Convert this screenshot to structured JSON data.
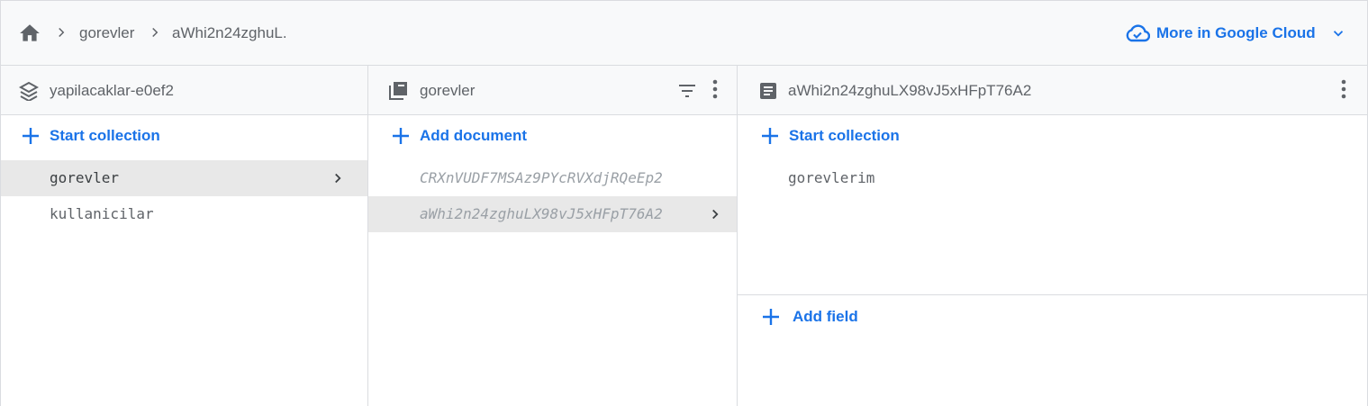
{
  "breadcrumb": {
    "home_icon": "home-icon",
    "items": [
      "gorevler",
      "aWhi2n24zghuL."
    ]
  },
  "cloud_button": {
    "label": "More in Google Cloud",
    "icon": "cloud-icon",
    "accent": "#1a73e8"
  },
  "panels": {
    "root": {
      "title": "yapilacaklar-e0ef2",
      "icon": "database-layers-icon",
      "action": "Start collection",
      "items": [
        "gorevler",
        "kullanicilar"
      ],
      "selected_index": 0
    },
    "collection": {
      "title": "gorevler",
      "icon": "collection-icon",
      "action": "Add document",
      "items": [
        "CRXnVUDF7MSAz9PYcRVXdjRQeEp2",
        "aWhi2n24zghuLX98vJ5xHFpT76A2"
      ],
      "selected_index": 1
    },
    "document": {
      "title": "aWhi2n24zghuLX98vJ5xHFpT76A2",
      "icon": "document-icon",
      "action": "Start collection",
      "items": [
        "gorevlerim"
      ],
      "add_field": "Add field"
    }
  }
}
